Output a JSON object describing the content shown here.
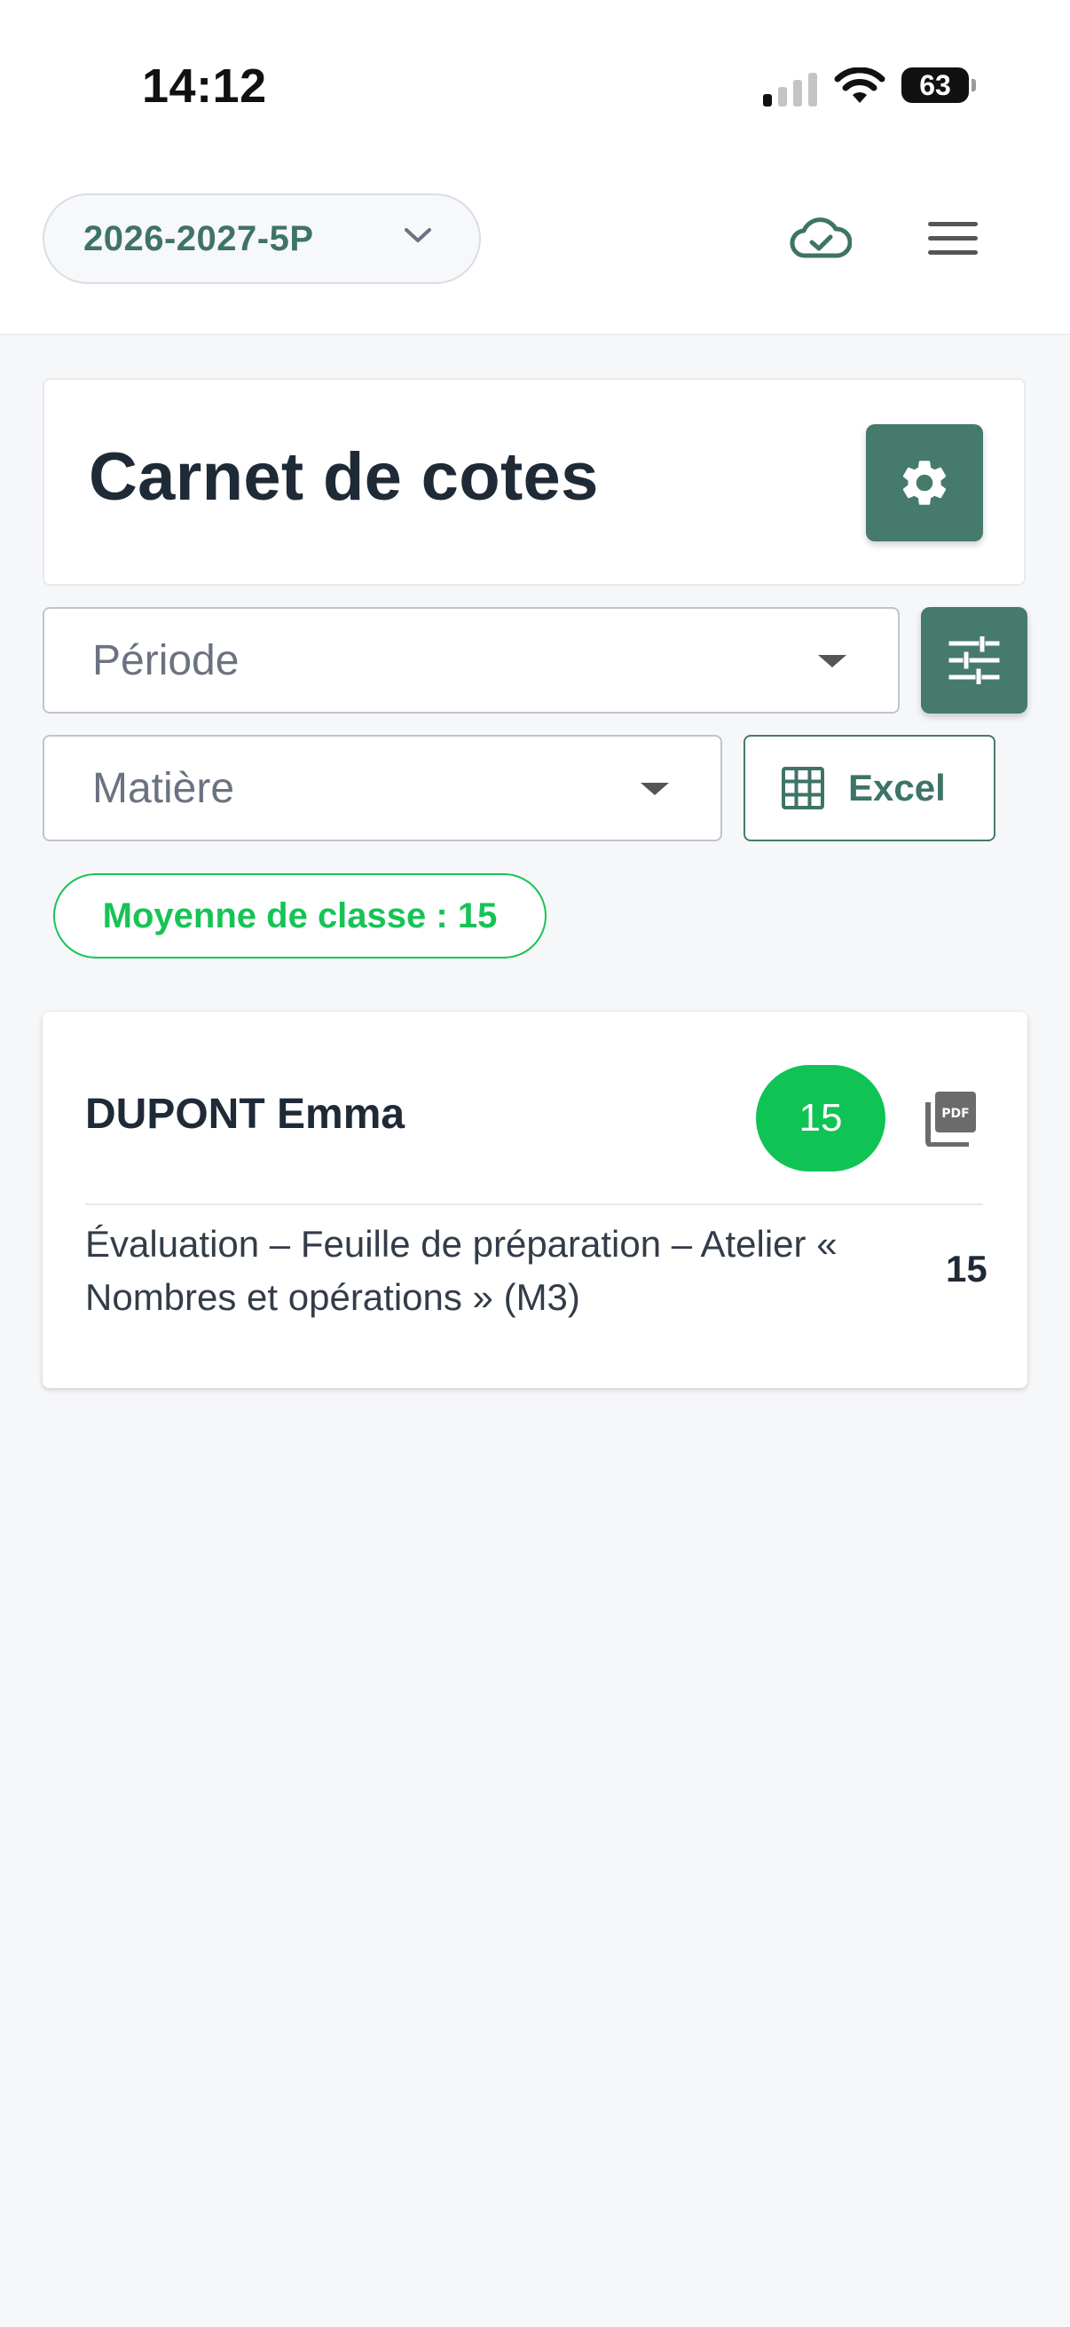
{
  "status_bar": {
    "time": "14:12",
    "battery": "63",
    "icons": [
      "signal-icon",
      "wifi-icon",
      "battery-icon"
    ]
  },
  "header": {
    "year_selector": "2026-2027-5P",
    "icons": [
      "chevron-down-icon",
      "cloud-check-icon",
      "menu-icon"
    ]
  },
  "page": {
    "title": "Carnet de cotes",
    "settings_icon": "gear-icon"
  },
  "filters": {
    "periode_placeholder": "Période",
    "matiere_placeholder": "Matière",
    "filter_icon": "sliders-icon",
    "excel_label": "Excel",
    "excel_icon": "grid-icon"
  },
  "class_average": {
    "label": "Moyenne de classe : 15"
  },
  "students": [
    {
      "name": "DUPONT Emma",
      "average": "15",
      "evaluations": [
        {
          "title": "Évaluation – Feuille de préparation – Atelier « Nombres et opérations » (M3)",
          "score": "15"
        }
      ]
    }
  ],
  "colors": {
    "accent": "#457a6c",
    "success": "#17c356",
    "background": "#f6f7f9",
    "text": "#1f2a37"
  }
}
